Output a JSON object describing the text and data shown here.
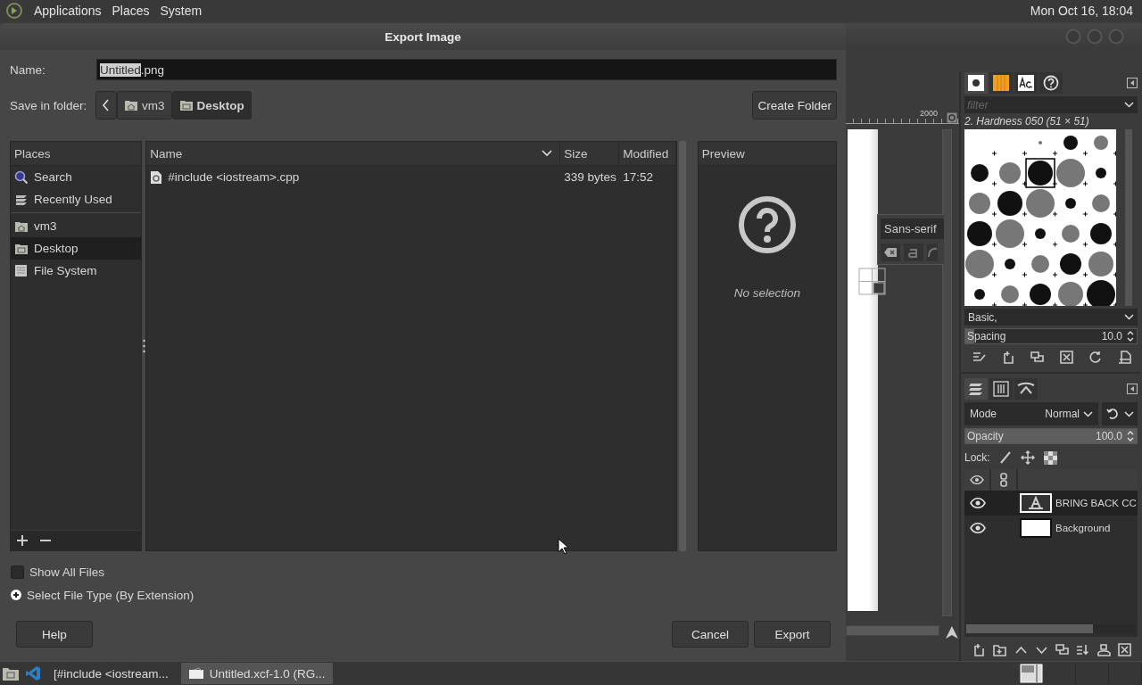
{
  "top_panel": {
    "menus": [
      "Applications",
      "Places",
      "System"
    ],
    "clock": "Mon Oct 16, 18:04"
  },
  "dialog": {
    "title": "Export Image",
    "name_field": {
      "label": "Name:",
      "selected_text": "Untitled",
      "rest_text": ".png"
    },
    "save_in": {
      "label": "Save in folder:",
      "path": [
        {
          "label": "vm3",
          "kind": "home",
          "selected": false
        },
        {
          "label": "Desktop",
          "kind": "desktop",
          "selected": true
        }
      ],
      "create_folder": "Create Folder"
    },
    "places": {
      "header": "Places",
      "groups": [
        [
          {
            "label": "Search",
            "kind": "search",
            "selected": false
          },
          {
            "label": "Recently Used",
            "kind": "recent",
            "selected": false
          }
        ],
        [
          {
            "label": "vm3",
            "kind": "home",
            "selected": false
          },
          {
            "label": "Desktop",
            "kind": "desktop",
            "selected": true
          },
          {
            "label": "File System",
            "kind": "drive",
            "selected": false
          }
        ]
      ]
    },
    "files": {
      "columns": [
        "Name",
        "Size",
        "Modified"
      ],
      "rows": [
        {
          "name": "#include <iostream>.cpp",
          "size": "339 bytes",
          "modified": "17:52",
          "selected": false
        }
      ]
    },
    "preview": {
      "header": "Preview",
      "message": "No selection"
    },
    "options": [
      {
        "label": "Show All Files",
        "kind": "checkbox",
        "checked": false
      },
      {
        "label": "Select File Type (By Extension)",
        "kind": "expander",
        "expanded": false
      }
    ],
    "buttons": {
      "help": "Help",
      "cancel": "Cancel",
      "export": "Export"
    }
  },
  "gimp": {
    "ruler_label": "2000",
    "text_toolbox": {
      "font": "Sans-serif"
    },
    "brushes": {
      "tabs": [
        {
          "kind": "brush",
          "selected": true
        },
        {
          "kind": "gradient",
          "selected": false
        },
        {
          "kind": "font",
          "selected": false
        },
        {
          "kind": "help",
          "selected": false
        }
      ],
      "filter_placeholder": "filter",
      "brush_name": "2. Hardness 050 (51 × 51)",
      "tag": "Basic,",
      "spacing": {
        "label": "Spacing",
        "value": "10.0",
        "level": 0.05
      }
    },
    "layers": {
      "tabs": [
        {
          "kind": "layers",
          "selected": true
        },
        {
          "kind": "channels",
          "selected": false
        },
        {
          "kind": "paths",
          "selected": false
        }
      ],
      "mode_label": "Mode",
      "mode": "Normal",
      "opacity": {
        "label": "Opacity",
        "value": "100.0",
        "level": 1
      },
      "lock_label": "Lock:",
      "items": [
        {
          "name": "BRING BACK CC",
          "kind": "text",
          "visible": true,
          "selected": true
        },
        {
          "name": "Background",
          "kind": "image",
          "visible": true,
          "selected": false
        }
      ]
    }
  },
  "taskbar": [
    {
      "label": "[#include <iostream...",
      "kind": "editor",
      "selected": false
    },
    {
      "label": "Untitled.xcf-1.0 (RG...",
      "kind": "gimp",
      "selected": true
    }
  ]
}
